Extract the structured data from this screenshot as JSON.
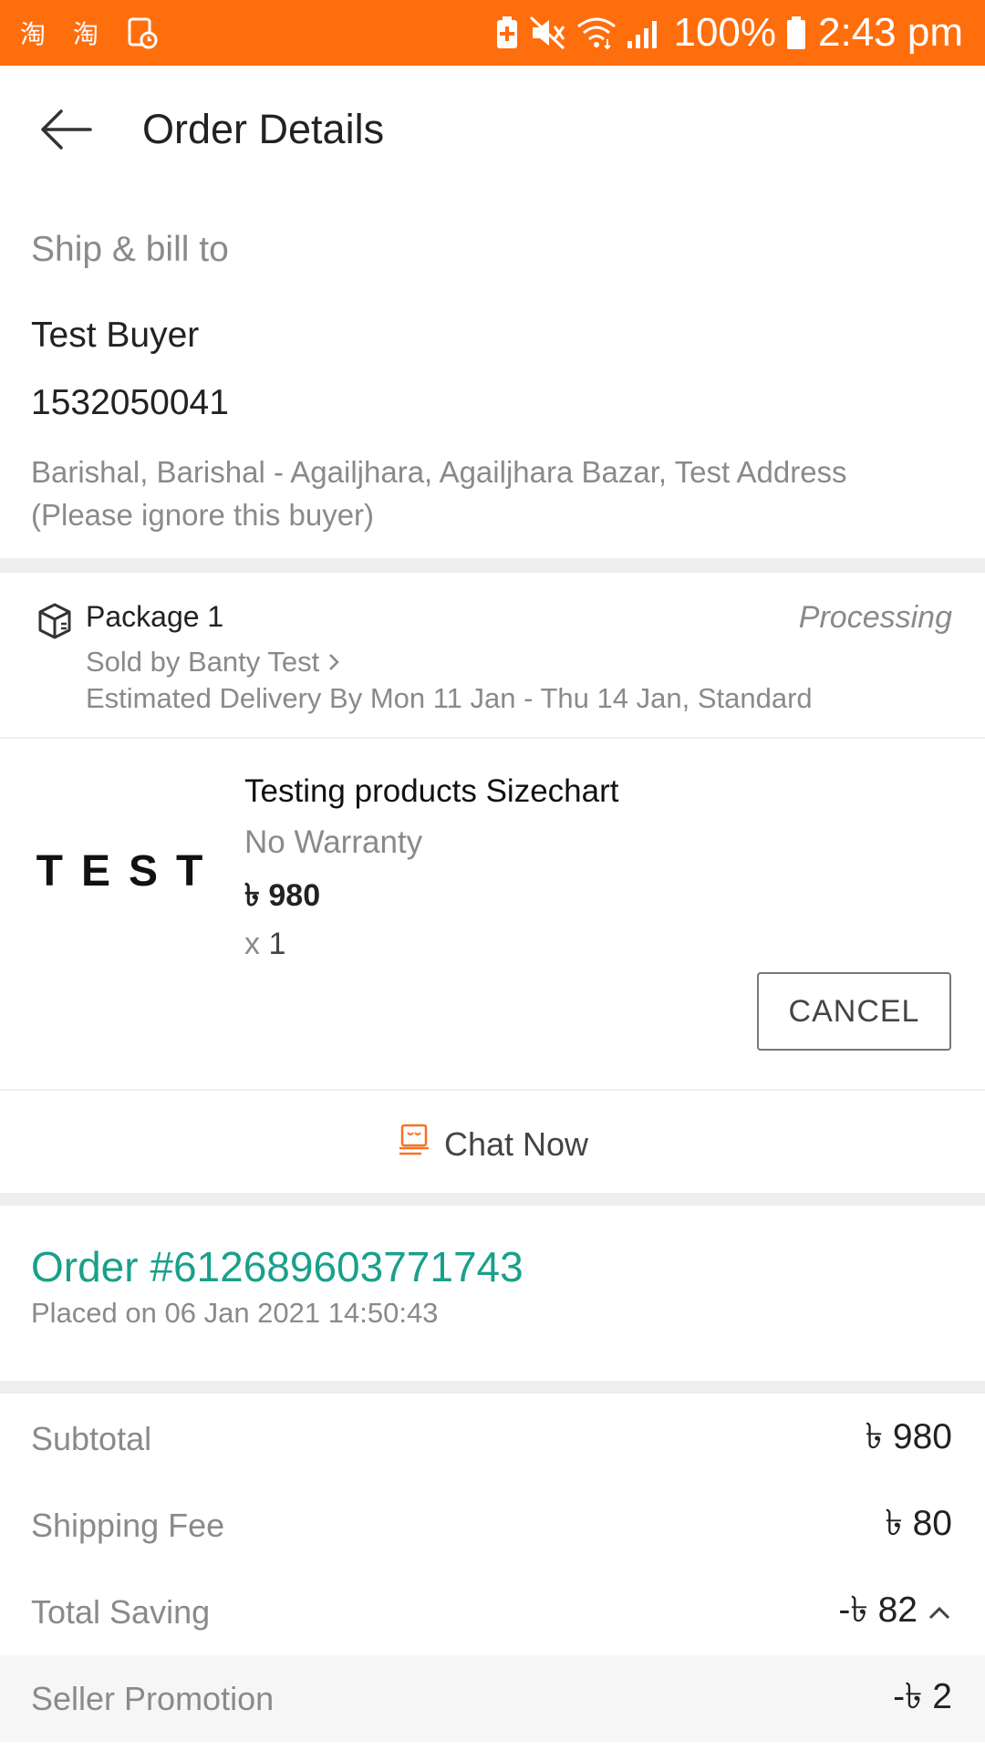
{
  "status_bar": {
    "battery_text": "100%",
    "time": "2:43 pm",
    "background": "#ff6e0d",
    "left_icons": [
      "taobao-icon",
      "taobao-icon",
      "screen-record-icon"
    ],
    "right_icons": [
      "battery-saver-icon",
      "mute-icon",
      "wifi-icon",
      "signal-icon",
      "battery-icon"
    ]
  },
  "header": {
    "title": "Order Details"
  },
  "ship_to": {
    "heading": "Ship & bill to",
    "name": "Test Buyer",
    "phone": "1532050041",
    "address": "Barishal, Barishal - Agailjhara, Agailjhara Bazar, Test Address (Please ignore this buyer)"
  },
  "package": {
    "title": "Package 1",
    "status": "Processing",
    "seller": "Sold by Banty Test",
    "delivery": "Estimated Delivery By Mon 11 Jan - Thu 14 Jan, Standard"
  },
  "item": {
    "thumbnail_text": "TEST",
    "name": "Testing products Sizechart",
    "warranty": "No Warranty",
    "price": "৳ 980",
    "qty_prefix": "x",
    "qty": "1",
    "cancel_label": "CANCEL"
  },
  "chat": {
    "label": "Chat Now",
    "icon": "chat-icon",
    "icon_color": "#f57224"
  },
  "order": {
    "number": "Order #612689603771743",
    "placed": "Placed on 06 Jan 2021  14:50:43",
    "accent": "#1aa08a"
  },
  "summary": [
    {
      "label": "Subtotal",
      "value": "৳ 980"
    },
    {
      "label": "Shipping Fee",
      "value": "৳ 80"
    },
    {
      "label": "Total Saving",
      "value": "-৳ 82"
    },
    {
      "label": "Seller Promotion",
      "value": "-৳ 2"
    }
  ]
}
